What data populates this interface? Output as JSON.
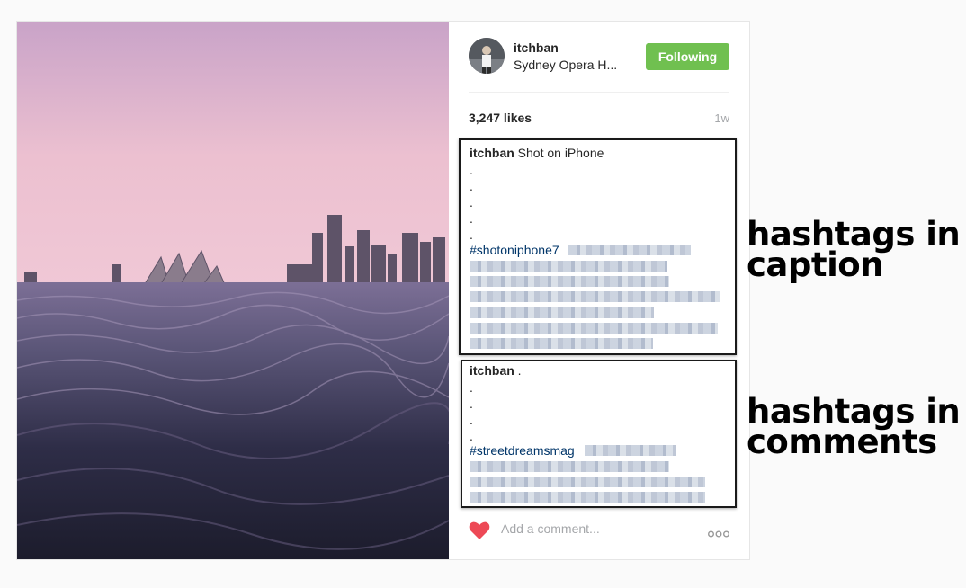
{
  "post": {
    "username": "itchban",
    "location": "Sydney Opera H...",
    "follow_label": "Following",
    "likes": "3,247 likes",
    "time": "1w",
    "caption": {
      "username": "itchban",
      "text": "Shot on iPhone",
      "dots": [
        ".",
        ".",
        ".",
        ".",
        "."
      ],
      "hashtag": "#shotoniphone7"
    },
    "comment": {
      "username": "itchban",
      "text": ".",
      "dots": [
        ".",
        ".",
        ".",
        "."
      ],
      "hashtag": "#streetdreamsmag"
    },
    "add_comment_placeholder": "Add a comment..."
  },
  "annotations": {
    "caption_label_line1": "hashtags in",
    "caption_label_line2": "caption",
    "comments_label_line1": "hashtags in",
    "comments_label_line2": "comments"
  },
  "colors": {
    "follow_button": "#70c050",
    "heart": "#ed4956",
    "hashtag": "#003569"
  },
  "icons": [
    "heart-icon",
    "more-options-icon"
  ]
}
